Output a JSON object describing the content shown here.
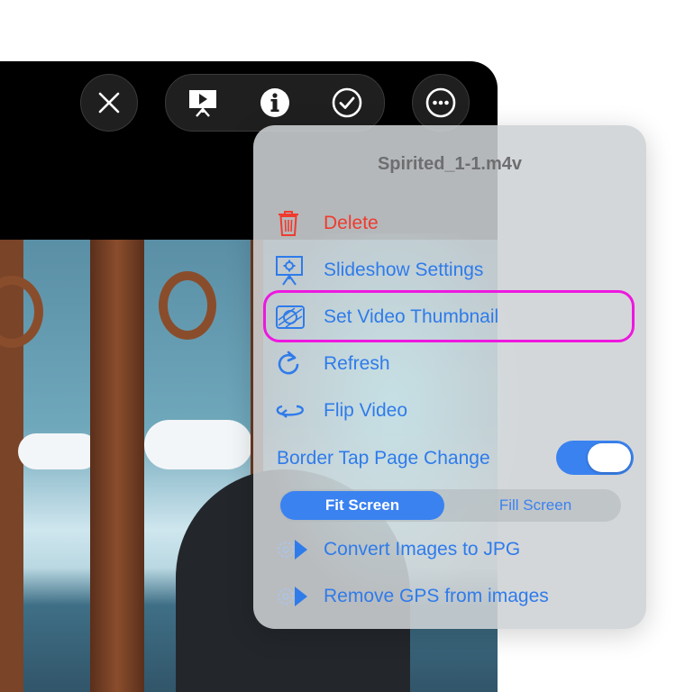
{
  "toolbar": {
    "close_icon": "close-icon",
    "slideshow_icon": "slideshow-icon",
    "info_icon": "info-icon",
    "checkmark_icon": "checkmark-icon",
    "more_icon": "ellipsis-icon"
  },
  "menu": {
    "title": "Spirited_1-1.m4v",
    "items": [
      {
        "label": "Delete",
        "icon": "trash-icon",
        "color": "#ef3b2f"
      },
      {
        "label": "Slideshow Settings",
        "icon": "slideshow-settings-icon",
        "color": "#2f7bea"
      },
      {
        "label": "Set Video Thumbnail",
        "icon": "video-thumbnail-icon",
        "color": "#2f7bea"
      },
      {
        "label": "Refresh",
        "icon": "refresh-icon",
        "color": "#2f7bea"
      },
      {
        "label": "Flip Video",
        "icon": "flip-icon",
        "color": "#2f7bea"
      }
    ],
    "toggle": {
      "label": "Border Tap Page Change",
      "on": true
    },
    "segmented": {
      "options": [
        "Fit Screen",
        "Fill Screen"
      ],
      "selected": "Fit Screen"
    },
    "extra_items": [
      {
        "label": "Convert Images to JPG",
        "icon": "gear-play-icon"
      },
      {
        "label": "Remove GPS from images",
        "icon": "gear-play-icon"
      }
    ]
  },
  "colors": {
    "accent": "#2f7bea",
    "danger": "#ef3b2f",
    "highlight": "#ee17e0"
  }
}
